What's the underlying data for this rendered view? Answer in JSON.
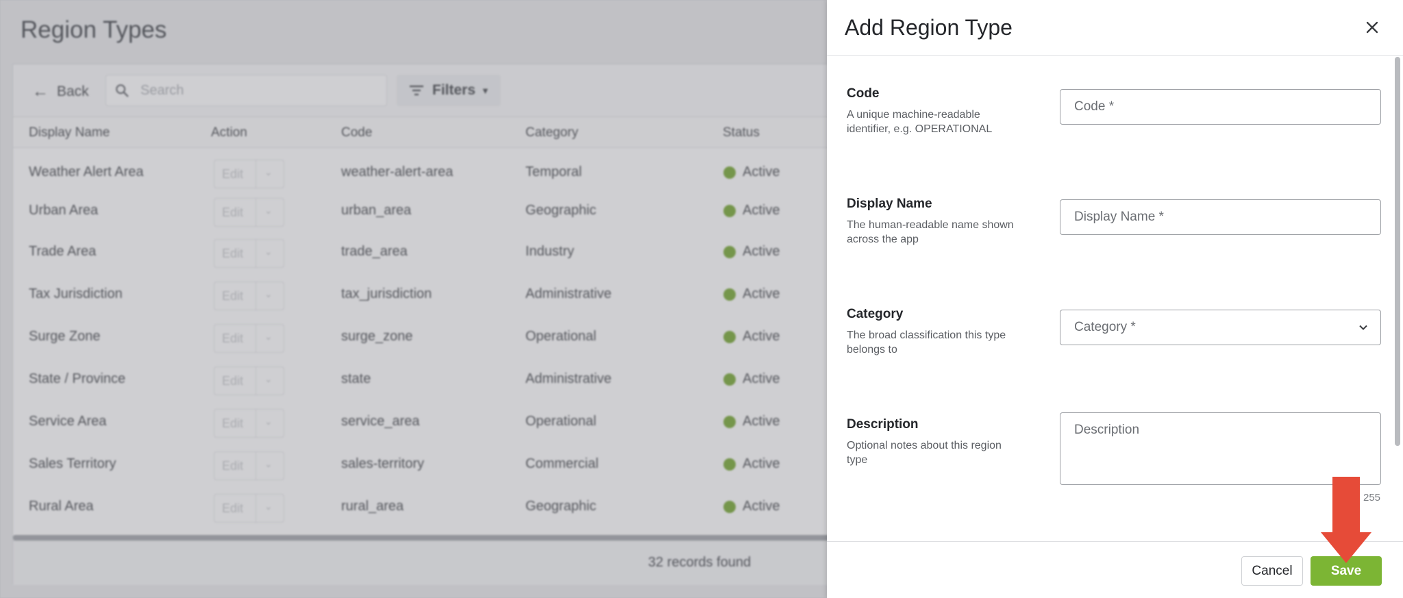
{
  "background_page": {
    "title": "Region Types",
    "toolbar": {
      "back_label": "Back",
      "search_placeholder": "Search",
      "filters_label": "Filters"
    },
    "table": {
      "columns": [
        "Display Name",
        "Action",
        "Code",
        "Category",
        "Status"
      ],
      "edit_label": "Edit",
      "rows": [
        {
          "display_name": "Weather Alert Area",
          "code": "weather-alert-area",
          "category": "Temporal",
          "status": "Active"
        },
        {
          "display_name": "Urban Area",
          "code": "urban_area",
          "category": "Geographic",
          "status": "Active"
        },
        {
          "display_name": "Trade Area",
          "code": "trade_area",
          "category": "Industry",
          "status": "Active"
        },
        {
          "display_name": "Tax Jurisdiction",
          "code": "tax_jurisdiction",
          "category": "Administrative",
          "status": "Active"
        },
        {
          "display_name": "Surge Zone",
          "code": "surge_zone",
          "category": "Operational",
          "status": "Active"
        },
        {
          "display_name": "State / Province",
          "code": "state",
          "category": "Administrative",
          "status": "Active"
        },
        {
          "display_name": "Service Area",
          "code": "service_area",
          "category": "Operational",
          "status": "Active"
        },
        {
          "display_name": "Sales Territory",
          "code": "sales-territory",
          "category": "Commercial",
          "status": "Active"
        },
        {
          "display_name": "Rural Area",
          "code": "rural_area",
          "category": "Geographic",
          "status": "Active"
        }
      ],
      "records_found": "32 records found"
    }
  },
  "drawer": {
    "title": "Add Region Type",
    "fields": {
      "code": {
        "label": "Code",
        "help": "A unique machine-readable identifier, e.g. OPERATIONAL",
        "placeholder": "Code *"
      },
      "display_name": {
        "label": "Display Name",
        "help": "The human-readable name shown across the app",
        "placeholder": "Display Name *"
      },
      "category": {
        "label": "Category",
        "help": "The broad classification this type belongs to",
        "placeholder": "Category *"
      },
      "description": {
        "label": "Description",
        "help": "Optional notes about this region type",
        "placeholder": "Description",
        "counter": "255"
      }
    },
    "cancel_label": "Cancel",
    "save_label": "Save"
  },
  "colors": {
    "accent_green": "#7cb534",
    "status_green": "#6fa326",
    "annotation_arrow": "#e64b38"
  },
  "icons": [
    "back-arrow-icon",
    "search-icon",
    "filter-icon",
    "caret-down-icon",
    "chevron-down-icon",
    "close-icon",
    "status-dot-icon",
    "annotation-arrow-icon"
  ]
}
